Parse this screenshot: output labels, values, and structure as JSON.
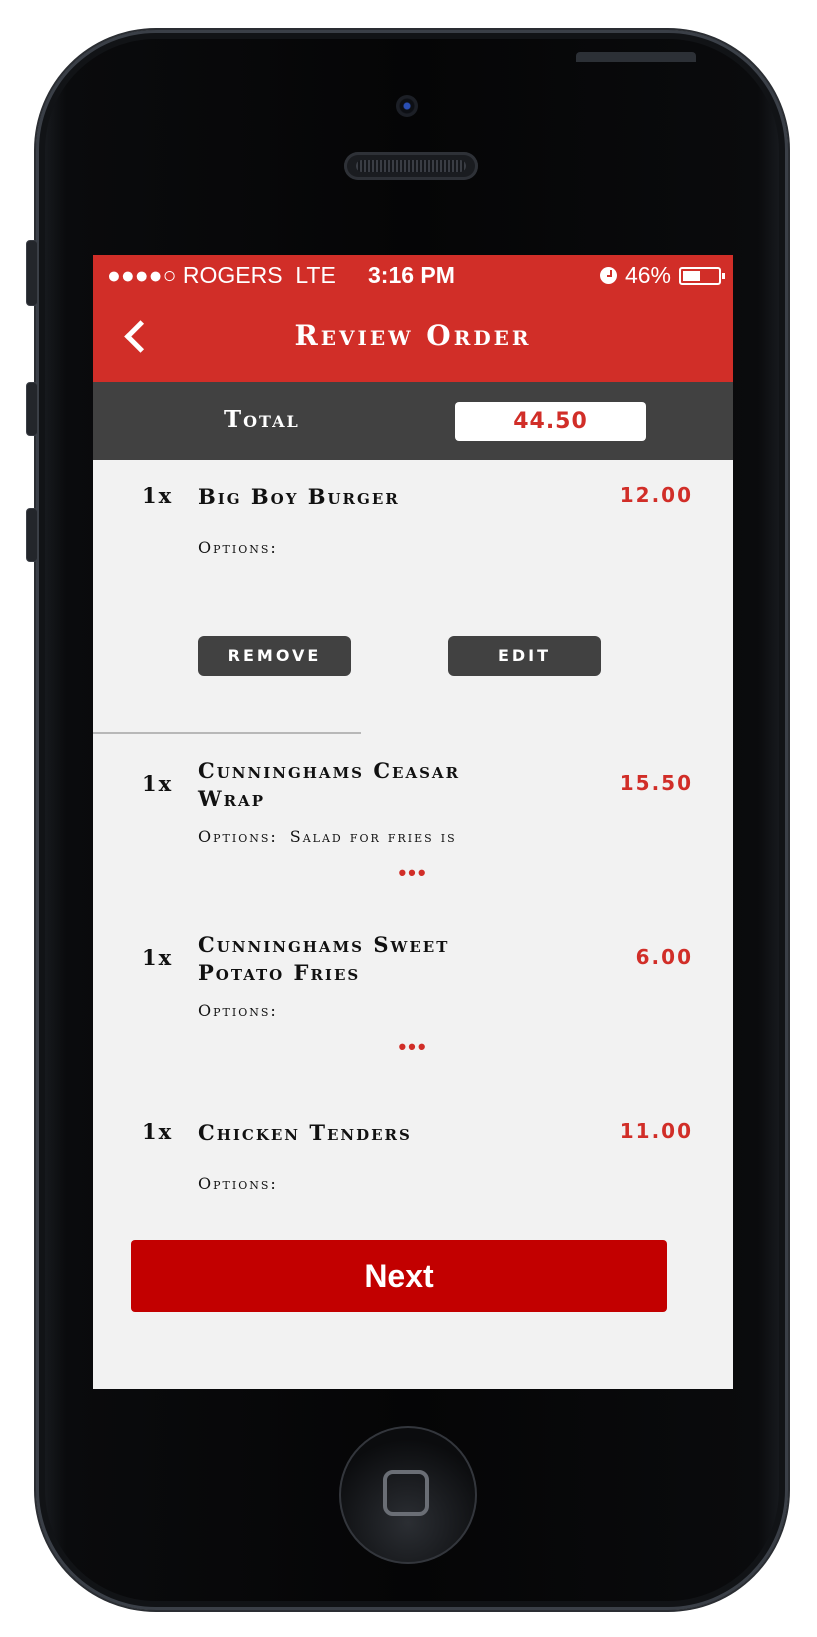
{
  "status_bar": {
    "carrier": "●●●●○ ROGERS",
    "network": "LTE",
    "time": "3:16 PM",
    "battery": "46%",
    "battery_level": 0.46
  },
  "navbar": {
    "title": "Review Order",
    "back_icon": "chevron-left-icon"
  },
  "total": {
    "label": "Total",
    "value": "44.50"
  },
  "items": [
    {
      "qty": "1x",
      "name": "Big Boy Burger",
      "price": "12.00",
      "options_label": "Options:",
      "options_value": "",
      "remove_label": "remove",
      "edit_label": "edit"
    },
    {
      "qty": "1x",
      "name": "Cunninghams Ceasar Wrap",
      "price": "15.50",
      "options_label": "Options:",
      "options_value": "Salad for fries is",
      "more": "•••"
    },
    {
      "qty": "1x",
      "name": "Cunninghams Sweet Potato Fries",
      "price": "6.00",
      "options_label": "Options:",
      "options_value": "",
      "more": "•••"
    },
    {
      "qty": "1x",
      "name": "Chicken Tenders",
      "price": "11.00",
      "options_label": "Options:",
      "options_value": ""
    }
  ],
  "next_button": {
    "label": "Next"
  },
  "colors": {
    "accent": "#d12e28",
    "dark_bar": "#414141",
    "next_button": "#c20000",
    "background": "#f2f2f2"
  }
}
